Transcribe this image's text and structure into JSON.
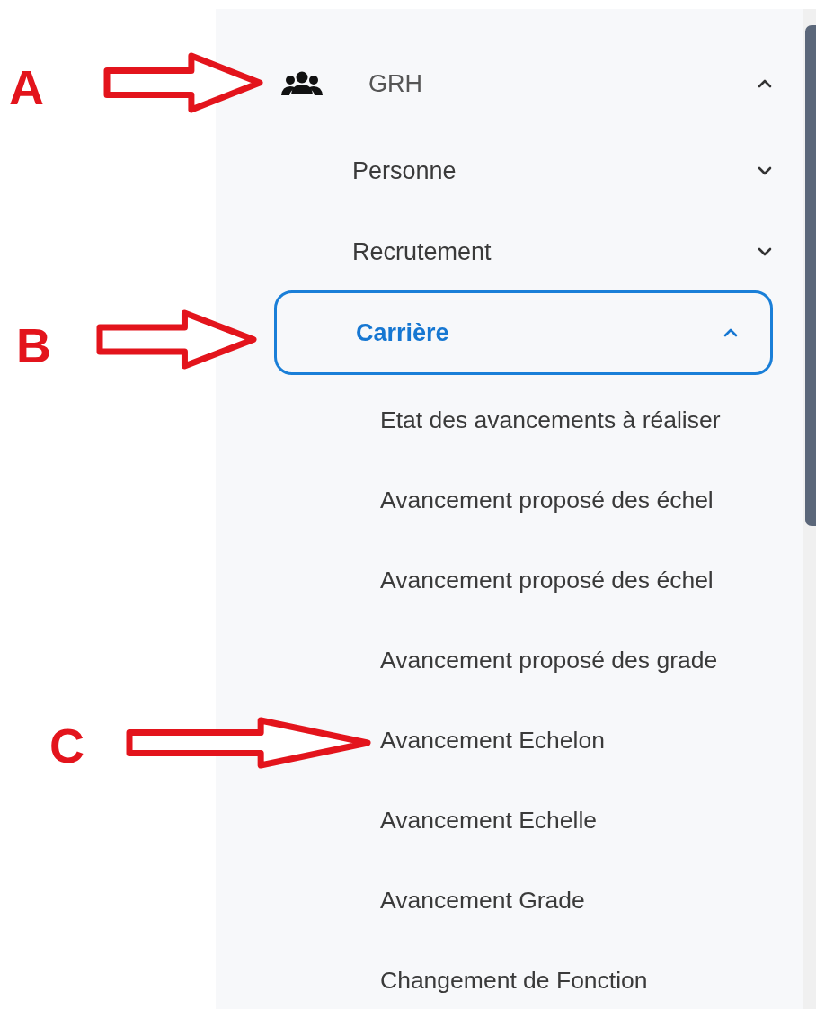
{
  "annotations": [
    {
      "label": "A"
    },
    {
      "label": "B"
    },
    {
      "label": "C"
    }
  ],
  "menu": {
    "label": "GRH",
    "expanded": true,
    "children": [
      {
        "label": "Personne",
        "expanded": false,
        "selected": false
      },
      {
        "label": "Recrutement",
        "expanded": false,
        "selected": false
      },
      {
        "label": "Carrière",
        "expanded": true,
        "selected": true,
        "children": [
          {
            "label": "Etat des avancements à réaliser"
          },
          {
            "label": "Avancement proposé des échel"
          },
          {
            "label": "Avancement proposé des échel"
          },
          {
            "label": "Avancement proposé des grade"
          },
          {
            "label": "Avancement Echelon"
          },
          {
            "label": "Avancement Echelle"
          },
          {
            "label": "Avancement Grade"
          },
          {
            "label": "Changement de Fonction"
          }
        ]
      }
    ]
  }
}
